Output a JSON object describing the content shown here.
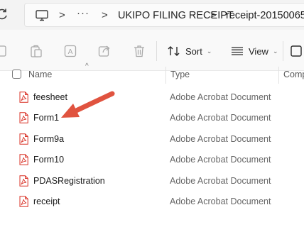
{
  "address_bar": {
    "ellipsis": "···",
    "breadcrumbs": [
      "UKIPO FILING RECEIPT",
      "receipt-20150065"
    ],
    "separator": ">"
  },
  "toolbar": {
    "sort_label": "Sort",
    "view_label": "View",
    "chevron": "⌄",
    "icons": [
      "new-icon",
      "copy-icon",
      "rename-icon",
      "share-icon",
      "delete-icon",
      "sort-icon",
      "view-icon"
    ]
  },
  "columns": {
    "name": "Name",
    "type": "Type",
    "compressed": "Comp",
    "sort_indicator": "^"
  },
  "files": [
    {
      "name": "feesheet",
      "type": "Adobe Acrobat Document"
    },
    {
      "name": "Form1",
      "type": "Adobe Acrobat Document"
    },
    {
      "name": "Form9a",
      "type": "Adobe Acrobat Document"
    },
    {
      "name": "Form10",
      "type": "Adobe Acrobat Document"
    },
    {
      "name": "PDASRegistration",
      "type": "Adobe Acrobat Document"
    },
    {
      "name": "receipt",
      "type": "Adobe Acrobat Document"
    }
  ],
  "annotation": {
    "arrow_color": "#e0533f",
    "points_to": "Form1"
  },
  "colors": {
    "pdf_red": "#d93025",
    "toolbar_bg": "#f9f9f9",
    "topbar_bg": "#f3f3f3"
  }
}
